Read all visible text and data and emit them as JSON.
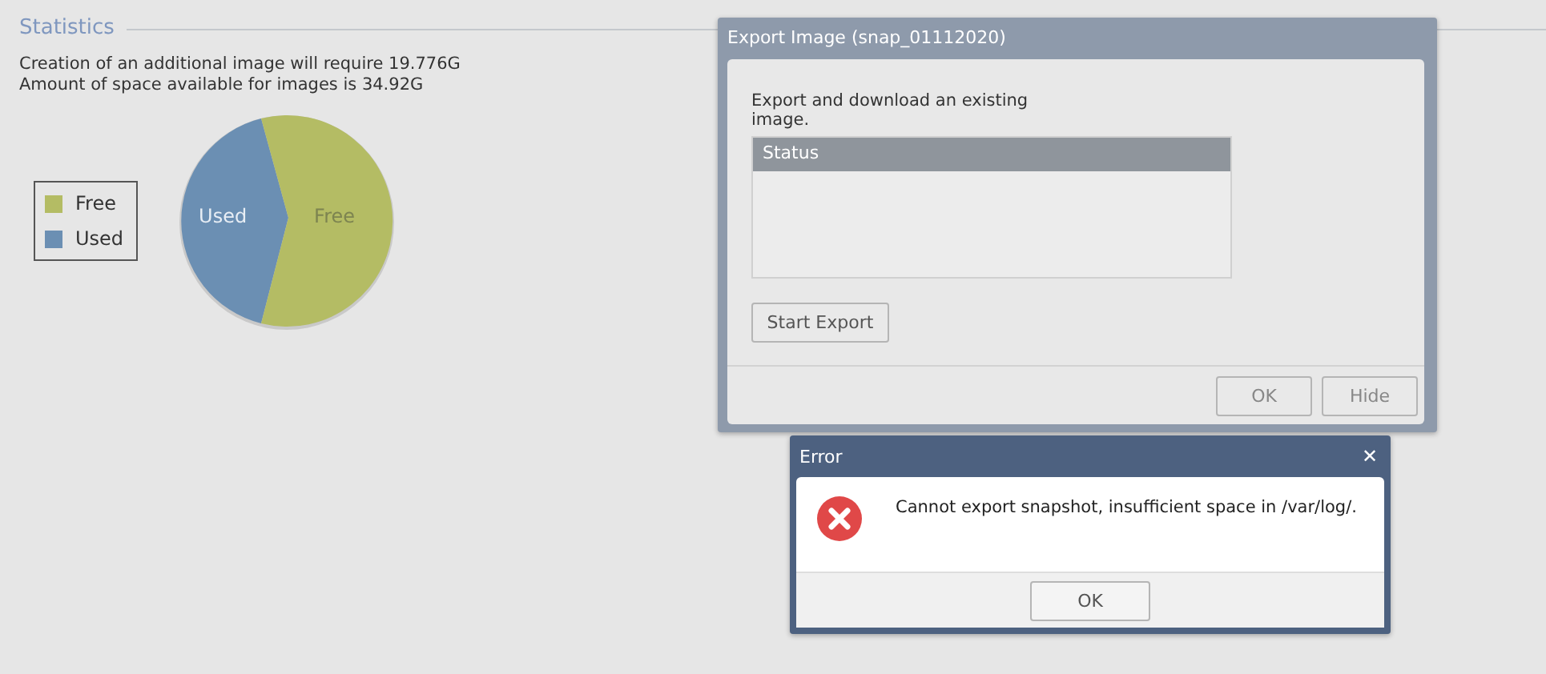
{
  "section": {
    "title": "Statistics"
  },
  "info_lines": [
    "Creation of an additional image will require 19.776G",
    "Amount of space available for images is 34.92G"
  ],
  "legend": [
    {
      "label": "Free",
      "color": "#b4bc64"
    },
    {
      "label": "Used",
      "color": "#6b8fb3"
    }
  ],
  "pie_labels": [
    "Used",
    "Free"
  ],
  "export_dialog": {
    "title": "Export Image (snap_01112020)",
    "description": "Export and download an existing image.",
    "status_header": "Status",
    "start_button": "Start Export",
    "buttons": [
      "OK",
      "Hide"
    ]
  },
  "error_dialog": {
    "title": "Error",
    "close": "✕",
    "message": "Cannot export snapshot, insufficient space in /var/log/.",
    "button": "OK"
  }
}
